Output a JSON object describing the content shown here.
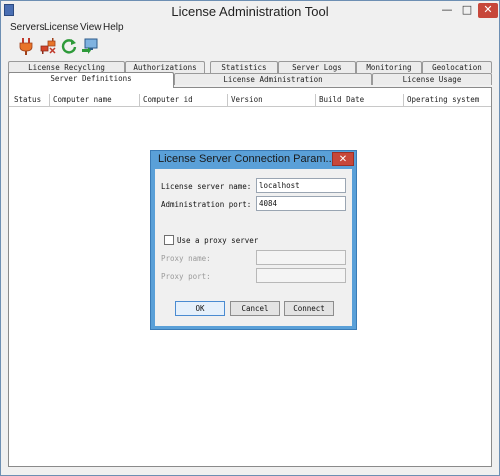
{
  "window": {
    "title": "License Administration Tool",
    "controls": {
      "minimize": "—",
      "maximize": "□",
      "close": "✕"
    }
  },
  "menu": [
    "Servers",
    "License",
    "View",
    "Help"
  ],
  "toolbar": {
    "icons": [
      "plug-connect-icon",
      "plug-disconnect-icon",
      "refresh-icon",
      "monitor-export-icon"
    ]
  },
  "tabs": {
    "row1": [
      "License Recycling",
      "Authorizations",
      "Statistics",
      "Server Logs",
      "Monitoring",
      "Geolocation"
    ],
    "row2": [
      "Server Definitions",
      "License Administration",
      "License Usage"
    ],
    "active": "Server Definitions"
  },
  "table": {
    "columns": [
      "Status",
      "Computer name",
      "Computer id",
      "Version",
      "Build Date",
      "Operating system"
    ]
  },
  "dialog": {
    "title": "License Server Connection Param...",
    "server_name_label": "License server name:",
    "server_name_value": "localhost",
    "admin_port_label": "Administration port:",
    "admin_port_value": "4084",
    "proxy_checkbox_label": "Use a proxy server",
    "proxy_checked": false,
    "proxy_name_label": "Proxy name:",
    "proxy_port_label": "Proxy port:",
    "ok_label": "OK",
    "cancel_label": "Cancel",
    "connect_label": "Connect"
  },
  "colors": {
    "dialog_frame": "#5aa0d8",
    "close_button": "#c7473a",
    "window_background": "#f0f0f0"
  }
}
